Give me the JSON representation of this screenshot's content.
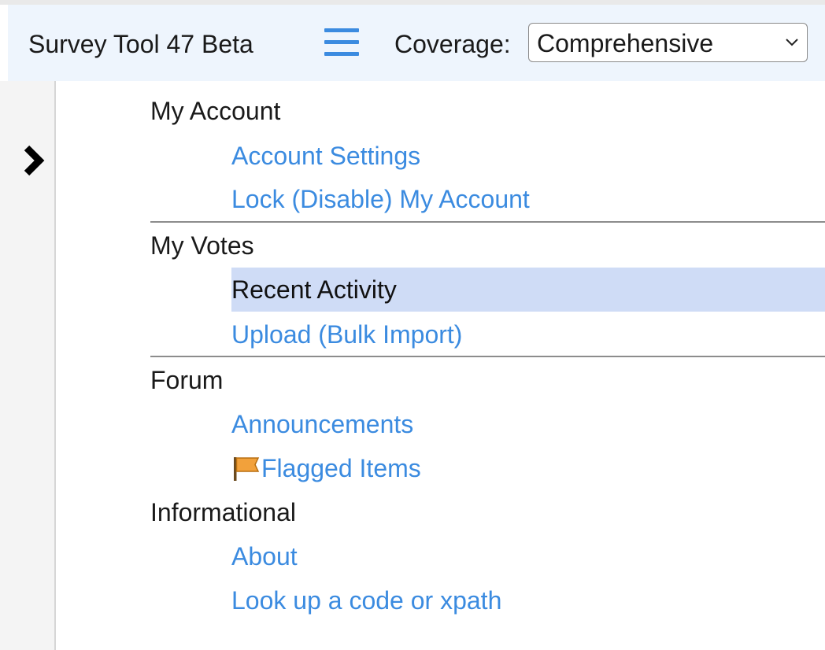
{
  "header": {
    "app_title": "Survey Tool 47 Beta",
    "menu_icon": "hamburger-menu-icon",
    "coverage_label": "Coverage:",
    "coverage_selected": "Comprehensive",
    "accent_color": "#3b8be0"
  },
  "sidebar": {
    "expand_icon": "chevron-right-icon"
  },
  "menu": {
    "my_account": {
      "heading": "My Account",
      "items": [
        "Account Settings",
        "Lock (Disable) My Account"
      ]
    },
    "my_votes": {
      "heading": "My Votes",
      "items": [
        "Recent Activity",
        "Upload (Bulk Import)"
      ],
      "selected": "Recent Activity"
    },
    "forum": {
      "heading": "Forum",
      "items": [
        "Announcements",
        "Flagged Items"
      ],
      "flag_icon": "flag-icon"
    },
    "informational": {
      "heading": "Informational",
      "items": [
        "About",
        "Look up a code or xpath"
      ]
    }
  }
}
